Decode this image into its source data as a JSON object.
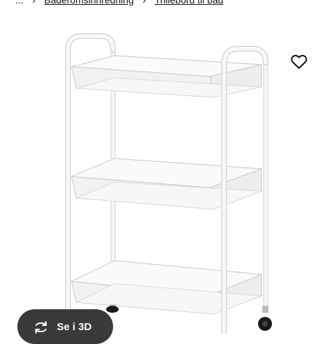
{
  "breadcrumb": {
    "items": [
      {
        "label": "..."
      },
      {
        "label": "Baderomsinnredning"
      },
      {
        "label": "Trillebord til bad"
      }
    ]
  },
  "product": {
    "image_alt": "Trillebord til bad",
    "colors": {
      "frame": "#f4f4f4",
      "basket": "#eeeeee",
      "outline": "#c9c9c9",
      "wheel": "#1a1a1a"
    }
  },
  "actions": {
    "favorite_icon": "heart-icon",
    "view_3d_label": "Se i 3D",
    "view_3d_icon": "rotate-3d-icon",
    "view_3d_bg": "#3a3a3a"
  }
}
